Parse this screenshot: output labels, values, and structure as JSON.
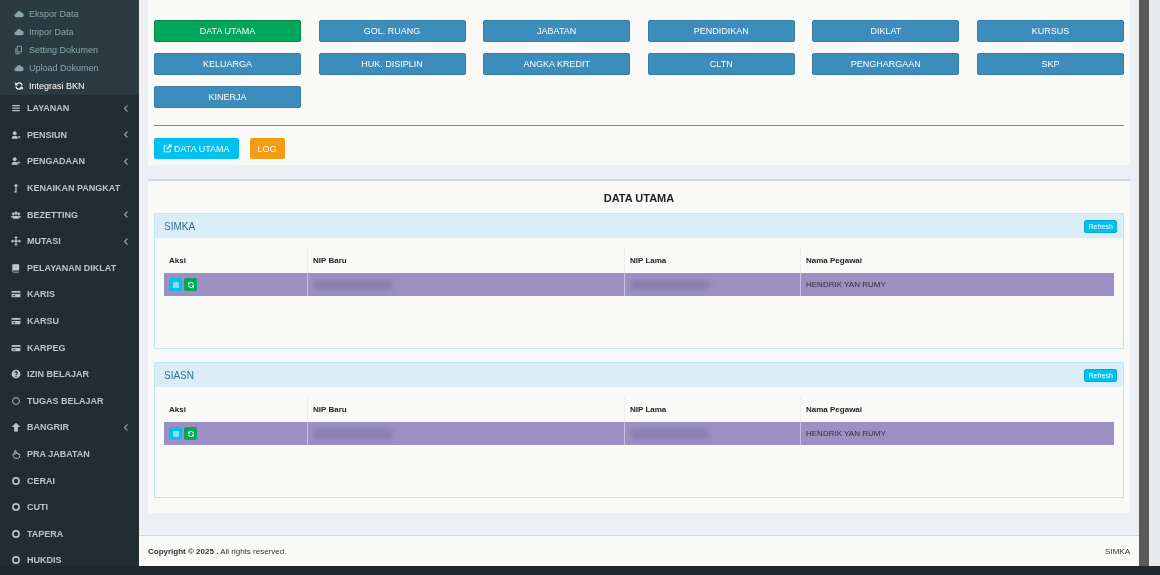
{
  "sidebar": {
    "subitems": [
      {
        "label": "Ekspor Data",
        "selected": false
      },
      {
        "label": "Impor Data",
        "selected": false
      },
      {
        "label": "Setting Dokumen",
        "selected": false
      },
      {
        "label": "Upload Dokumen",
        "selected": false
      },
      {
        "label": "Integrasi BKN",
        "selected": true
      }
    ],
    "items": [
      {
        "label": "LAYANAN",
        "has_submenu": true
      },
      {
        "label": "PENSIUN",
        "has_submenu": true
      },
      {
        "label": "PENGADAAN",
        "has_submenu": true
      },
      {
        "label": "KENAIKAN PANGKAT",
        "has_submenu": false
      },
      {
        "label": "BEZETTING",
        "has_submenu": true
      },
      {
        "label": "MUTASI",
        "has_submenu": true
      },
      {
        "label": "PELAYANAN DIKLAT",
        "has_submenu": false
      },
      {
        "label": "KARIS",
        "has_submenu": false
      },
      {
        "label": "KARSU",
        "has_submenu": false
      },
      {
        "label": "KARPEG",
        "has_submenu": false
      },
      {
        "label": "IZIN BELAJAR",
        "has_submenu": false
      },
      {
        "label": "TUGAS BELAJAR",
        "has_submenu": false
      },
      {
        "label": "BANGRIR",
        "has_submenu": true
      },
      {
        "label": "PRA JABATAN",
        "has_submenu": false
      },
      {
        "label": "CERAI",
        "has_submenu": false
      },
      {
        "label": "CUTI",
        "has_submenu": false
      },
      {
        "label": "TAPERA",
        "has_submenu": false
      },
      {
        "label": "HUKDIS",
        "has_submenu": false
      }
    ]
  },
  "tabs": [
    {
      "label": "DATA UTAMA",
      "selected": true
    },
    {
      "label": "GOL. RUANG",
      "selected": false
    },
    {
      "label": "JABATAN",
      "selected": false
    },
    {
      "label": "PENDIDIKAN",
      "selected": false
    },
    {
      "label": "DIKLAT",
      "selected": false
    },
    {
      "label": "KURSUS",
      "selected": false
    },
    {
      "label": "KELUARGA",
      "selected": false
    },
    {
      "label": "HUK. DISIPLIN",
      "selected": false
    },
    {
      "label": "ANGKA KREDIT",
      "selected": false
    },
    {
      "label": "CLTN",
      "selected": false
    },
    {
      "label": "PENGHARGAAN",
      "selected": false
    },
    {
      "label": "SKP",
      "selected": false
    },
    {
      "label": "KINERJA",
      "selected": false
    }
  ],
  "actions": [
    {
      "label": "DATA UTAMA",
      "kind": "edit"
    },
    {
      "label": "LOG",
      "kind": "log"
    }
  ],
  "section_title": "DATA UTAMA",
  "panels": [
    {
      "title": "SIMKA",
      "refresh": "Refresh",
      "columns": [
        "Aksi",
        "NIP Baru",
        "NIP Lama",
        "Nama Pegawai"
      ],
      "rows": [
        {
          "cells": [
            {
              "kind": "actions"
            },
            {
              "kind": "redacted"
            },
            {
              "kind": "redacted"
            },
            {
              "kind": "text",
              "text": "HENDRIK YAN RUMY"
            }
          ]
        }
      ]
    },
    {
      "title": "SIASN",
      "refresh": "Refresh",
      "columns": [
        "Aksi",
        "NIP Baru",
        "NIP Lama",
        "Nama Pegawai"
      ],
      "rows": [
        {
          "cells": [
            {
              "kind": "actions"
            },
            {
              "kind": "redacted"
            },
            {
              "kind": "redacted"
            },
            {
              "kind": "text",
              "text": "HENDRIK YAN RUMY"
            }
          ]
        }
      ]
    }
  ],
  "footer": {
    "copyright": "**Copyright © 2025 .** All rights reserved.",
    "brand": "SIMKA"
  }
}
